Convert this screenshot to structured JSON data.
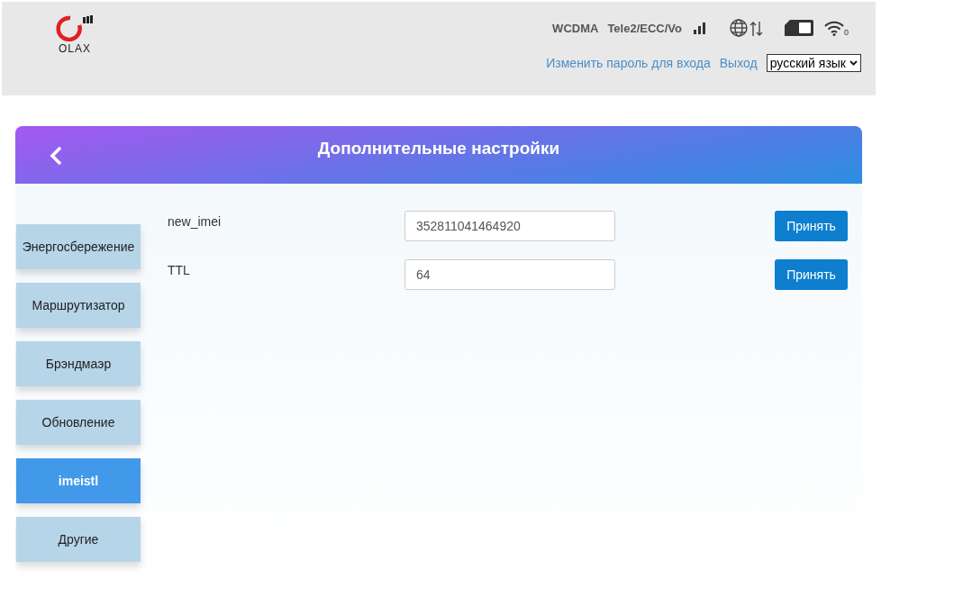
{
  "header": {
    "logo_text": "OLAX",
    "network_type": "WCDMA",
    "operator": "Tele2/ECC/Vo",
    "wifi_clients": "0",
    "links": [
      "Изменить пароль для входа",
      "Выход"
    ],
    "language": {
      "value": "русский язык"
    }
  },
  "panel": {
    "title": "Дополнительные настройки",
    "sidebar": [
      {
        "label": "Энергосбережение",
        "selected": false
      },
      {
        "label": "Маршрутизатор",
        "selected": false
      },
      {
        "label": "Брэндмаэр",
        "selected": false
      },
      {
        "label": "Обновление",
        "selected": false
      },
      {
        "label": "imeistl",
        "selected": true
      },
      {
        "label": "Другие",
        "selected": false
      }
    ],
    "fields": [
      {
        "label": "new_imei",
        "value": "352811041464920",
        "button": "Принять"
      },
      {
        "label": "TTL",
        "value": "64",
        "button": "Принять"
      }
    ]
  }
}
